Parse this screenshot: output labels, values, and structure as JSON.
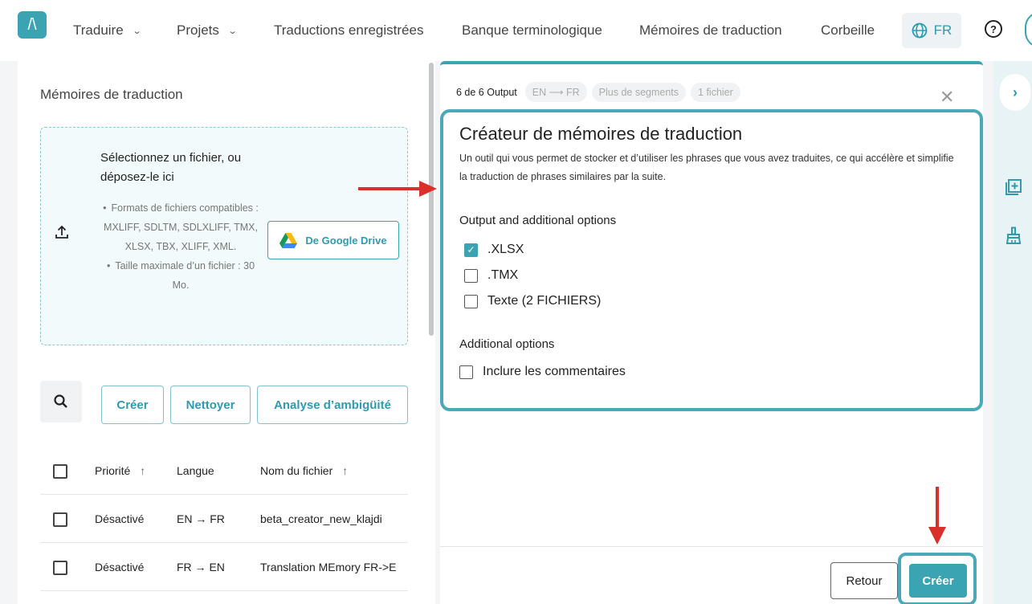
{
  "nav": {
    "logo": "/\\",
    "items": [
      {
        "label": "Traduire",
        "dropdown": true
      },
      {
        "label": "Projets",
        "dropdown": true
      },
      {
        "label": "Traductions enregistrées",
        "dropdown": false
      },
      {
        "label": "Banque terminologique",
        "dropdown": false
      },
      {
        "label": "Mémoires de traduction",
        "dropdown": false
      },
      {
        "label": "Corbeille",
        "dropdown": false
      }
    ],
    "language": "FR",
    "help_symbol": "?"
  },
  "left": {
    "title": "Mémoires de traduction",
    "dropzone": {
      "heading": "Sélectionnez un fichier, ou déposez-le ici",
      "formats": "Formats de fichiers compatibles : MXLIFF, SDLTM, SDLXLIFF, TMX, XLSX, TBX, XLIFF, XML.",
      "max_size": "Taille maximale d’un fichier : 30 Mo.",
      "gdrive_label": "De Google Drive"
    },
    "actions": {
      "create": "Créer",
      "clean": "Nettoyer",
      "ambiguity": "Analyse d’ambigüité"
    },
    "table": {
      "headers": {
        "priority": "Priorité",
        "sort_arrow": "↑",
        "language": "Langue",
        "filename": "Nom du fichier"
      },
      "rows": [
        {
          "priority": "Désactivé",
          "language": "EN → FR",
          "filename": "beta_creator_new_klajdi"
        },
        {
          "priority": "Désactivé",
          "language": "FR → EN",
          "filename": "Translation MEmory FR->E"
        }
      ]
    }
  },
  "drawer": {
    "crumb_main": "6 de 6 Output",
    "pills": [
      "EN ⟶ FR",
      "Plus de segments",
      "1 fichier"
    ],
    "title": "Créateur de mémoires de traduction",
    "description": "Un outil qui vous permet de stocker et d’utiliser les phrases que vous avez traduites, ce qui accélère et simplifie la traduction de phrases similaires par la suite.",
    "output_label": "Output and additional options",
    "output_options": [
      {
        "label": ".XLSX",
        "checked": true
      },
      {
        "label": ".TMX",
        "checked": false
      },
      {
        "label": "Texte (2 FICHIERS)",
        "checked": false
      }
    ],
    "additional_label": "Additional options",
    "additional_options": [
      {
        "label": "Inclure les commentaires",
        "checked": false
      }
    ],
    "back_label": "Retour",
    "create_label": "Créer"
  },
  "colors": {
    "accent": "#3aa4b3",
    "annotation_arrow": "#d9302c"
  }
}
